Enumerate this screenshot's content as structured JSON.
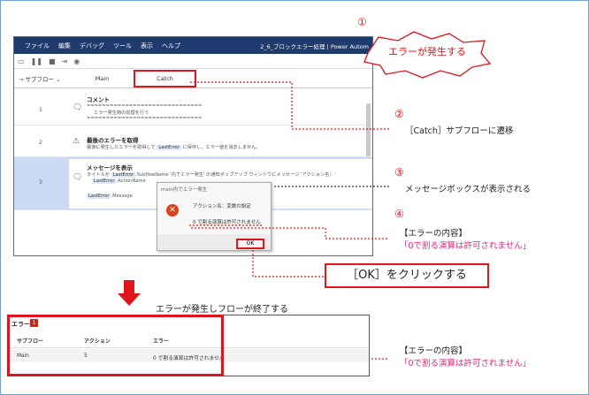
{
  "app": {
    "menu": [
      "ファイル",
      "編集",
      "デバッグ",
      "ツール",
      "表示",
      "ヘルプ"
    ],
    "title": "2_6_ブロックエラー処理 | Power Autom",
    "subflow_label": "サブフロー",
    "tabs": [
      "Main",
      "Catch"
    ]
  },
  "actions": [
    {
      "num": "1",
      "title": "コメント",
      "line1": "==============================",
      "line2": "エラー発生時の処理を行う",
      "line3": "=============================="
    },
    {
      "num": "2",
      "title": "最後のエラーを取得",
      "desc_a": "最後に発生したエラーを取得して",
      "var": "LastError",
      "desc_b": "に保存し、エラー値を消去しません。"
    },
    {
      "num": "3",
      "title": "メッセージを表示",
      "desc_a": "タイトルが",
      "var1": "LastError",
      "var1b": ".SubflowName",
      "desc_b": "'内でエラー発生' の通知ポップアップ ウィンドウにメッセージ 'アクション名：'",
      "var2": "LastError",
      "var2b": ".ActionName",
      "var3": "LastError",
      "var3b": ".Message"
    }
  ],
  "dialog": {
    "title": "main内でエラー発生",
    "line1": "アクション名：変数の設定",
    "line2": "0 で割る演算は許可されません",
    "ok": "OK"
  },
  "callouts": {
    "c1": "①",
    "burst": "エラーが発生する",
    "c2": "②",
    "note2": "［Catch］サブフローに遷移",
    "c3": "③",
    "note3": "メッセージボックスが表示される",
    "c4": "④",
    "note4a": "【エラーの内容】",
    "note4b": "「0で割る演算は許可されません」",
    "click": "［OK］をクリックする",
    "flow_end": "エラーが発生しフローが終了する",
    "note5a": "【エラーの内容】",
    "note5b": "「0で割る演算は許可されません」"
  },
  "error_panel": {
    "title": "エラー",
    "badge": "1",
    "columns": [
      "サブフロー",
      "アクション",
      "エラー"
    ],
    "row": [
      "Main",
      "5",
      "0 で割る演算は許可されません"
    ]
  }
}
